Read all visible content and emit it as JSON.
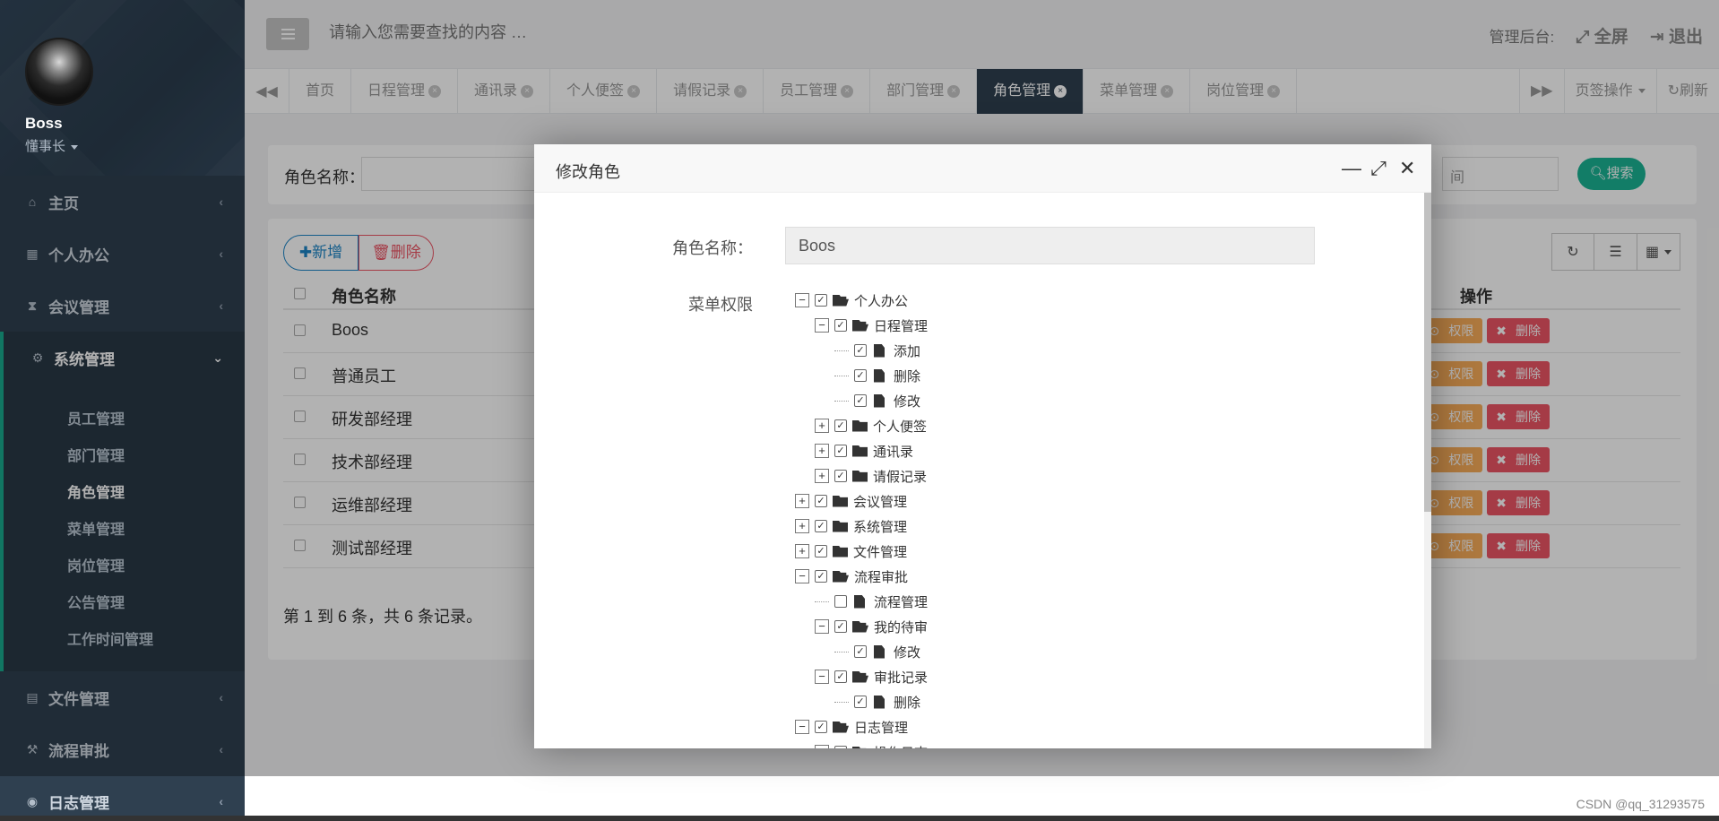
{
  "profile": {
    "name": "Boss",
    "role": "懂事长"
  },
  "sidebar": {
    "items": [
      {
        "label": "主页",
        "icon": "home-icon"
      },
      {
        "label": "个人办公",
        "icon": "calendar-icon"
      },
      {
        "label": "会议管理",
        "icon": "hourglass-icon"
      },
      {
        "label": "系统管理",
        "icon": "gear-icon"
      },
      {
        "label": "文件管理",
        "icon": "file-icon"
      },
      {
        "label": "流程审批",
        "icon": "gavel-icon"
      },
      {
        "label": "日志管理",
        "icon": "eye-icon"
      }
    ],
    "submenu": [
      "员工管理",
      "部门管理",
      "角色管理",
      "菜单管理",
      "岗位管理",
      "公告管理",
      "工作时间管理"
    ]
  },
  "topbar": {
    "search_placeholder": "请输入您需要查找的内容 …",
    "admin_label": "管理后台:",
    "fullscreen_label": "全屏",
    "logout_label": "退出"
  },
  "tabs": [
    "首页",
    "日程管理",
    "通讯录",
    "个人便签",
    "请假记录",
    "员工管理",
    "部门管理",
    "角色管理",
    "菜单管理",
    "岗位管理"
  ],
  "tab_actions": {
    "ops_label": "页签操作",
    "refresh_label": "刷新"
  },
  "search_panel": {
    "label": "角色名称：",
    "end_placeholder": "间",
    "search_button": "搜索"
  },
  "table": {
    "add_button": "新增",
    "delete_button": "删除",
    "header_name": "角色名称",
    "header_ops": "操作",
    "rows": [
      "Boos",
      "普通员工",
      "研发部经理",
      "技术部经理",
      "运维部经理",
      "测试部经理"
    ],
    "perm_label": "权限",
    "del_label": "删除",
    "pager": "第 1 到 6 条，共 6 条记录。"
  },
  "modal": {
    "title": "修改角色",
    "role_label": "角色名称：",
    "role_value": "Boos",
    "perm_label": "菜单权限"
  },
  "tree": [
    {
      "level": 0,
      "switch": "minus",
      "checked": true,
      "icon": "folder-open",
      "label": "个人办公"
    },
    {
      "level": 1,
      "switch": "minus",
      "checked": true,
      "icon": "folder-open",
      "label": "日程管理"
    },
    {
      "level": 2,
      "switch": "none",
      "checked": true,
      "icon": "file",
      "label": "添加"
    },
    {
      "level": 2,
      "switch": "none",
      "checked": true,
      "icon": "file",
      "label": "删除"
    },
    {
      "level": 2,
      "switch": "none",
      "checked": true,
      "icon": "file",
      "label": "修改"
    },
    {
      "level": 1,
      "switch": "plus",
      "checked": true,
      "icon": "folder",
      "label": "个人便签"
    },
    {
      "level": 1,
      "switch": "plus",
      "checked": true,
      "icon": "folder",
      "label": "通讯录"
    },
    {
      "level": 1,
      "switch": "plus",
      "checked": true,
      "icon": "folder",
      "label": "请假记录"
    },
    {
      "level": 0,
      "switch": "plus",
      "checked": true,
      "icon": "folder",
      "label": "会议管理"
    },
    {
      "level": 0,
      "switch": "plus",
      "checked": true,
      "icon": "folder",
      "label": "系统管理"
    },
    {
      "level": 0,
      "switch": "plus",
      "checked": true,
      "icon": "folder",
      "label": "文件管理"
    },
    {
      "level": 0,
      "switch": "minus",
      "checked": true,
      "icon": "folder-open",
      "label": "流程审批"
    },
    {
      "level": 1,
      "switch": "none",
      "checked": false,
      "icon": "file",
      "label": "流程管理"
    },
    {
      "level": 1,
      "switch": "minus",
      "checked": true,
      "icon": "folder-open",
      "label": "我的待审"
    },
    {
      "level": 2,
      "switch": "none",
      "checked": true,
      "icon": "file",
      "label": "修改"
    },
    {
      "level": 1,
      "switch": "minus",
      "checked": true,
      "icon": "folder-open",
      "label": "审批记录"
    },
    {
      "level": 2,
      "switch": "none",
      "checked": true,
      "icon": "file",
      "label": "删除"
    },
    {
      "level": 0,
      "switch": "minus",
      "checked": true,
      "icon": "folder-open",
      "label": "日志管理"
    },
    {
      "level": 1,
      "switch": "minus",
      "checked": true,
      "icon": "folder-open",
      "label": "操作日志"
    }
  ],
  "watermark": "CSDN @qq_31293575",
  "colors": {
    "sidebar": "#2f4050",
    "accent": "#1ab394",
    "primary": "#1c84c6",
    "warning": "#f8ac59",
    "danger": "#ed5565"
  }
}
